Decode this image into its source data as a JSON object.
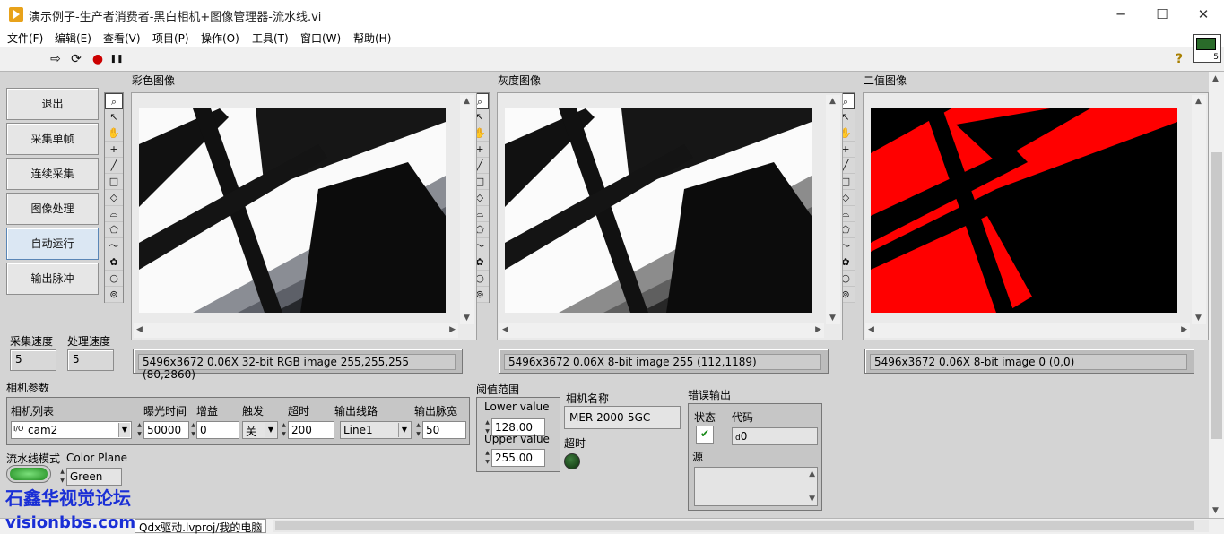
{
  "window": {
    "title": "演示例子-生产者消费者-黑白相机+图像管理器-流水线.vi",
    "min": "─",
    "max": "☐",
    "close": "✕"
  },
  "menu": [
    "文件(F)",
    "编辑(E)",
    "查看(V)",
    "项目(P)",
    "操作(O)",
    "工具(T)",
    "窗口(W)",
    "帮助(H)"
  ],
  "toolbar": {
    "run": "⇨",
    "run_cont": "⟳",
    "abort": "●",
    "pause": "❚❚",
    "help": "?"
  },
  "vi_icon": {
    "number": "5"
  },
  "buttons": [
    "退出",
    "采集单帧",
    "连续采集",
    "图像处理",
    "自动运行",
    "输出脉冲"
  ],
  "displays": [
    {
      "label": "彩色图像",
      "info": "5496x3672 0.06X 32-bit RGB image 255,255,255    (80,2860)"
    },
    {
      "label": "灰度图像",
      "info": "5496x3672 0.06X 8-bit image 255     (112,1189)"
    },
    {
      "label": "二值图像",
      "info": "5496x3672 0.06X 8-bit image 0     (0,0)"
    }
  ],
  "palette_tools": [
    "⌕",
    "↖",
    "✋",
    "+",
    "╱",
    "□",
    "◇",
    "⌓",
    "⬠",
    "〜",
    "✿",
    "○",
    "⊚"
  ],
  "speed": {
    "acq_label": "采集速度",
    "acq_value": "5",
    "proc_label": "处理速度",
    "proc_value": "5"
  },
  "camera": {
    "label": "相机参数",
    "list_label": "相机列表",
    "list_value": "cam2",
    "list_prefix": "I/O",
    "exposure_label": "曝光时间",
    "exposure_value": "50000",
    "gain_label": "增益",
    "gain_value": "0",
    "trigger_label": "触发",
    "trigger_value": "关",
    "timeout_label": "超时",
    "timeout_value": "200",
    "line_label": "输出线路",
    "line_value": "Line1",
    "pulse_label": "输出脉宽",
    "pulse_value": "50"
  },
  "threshold": {
    "label": "阈值范围",
    "lower_label": "Lower value",
    "lower_value": "128.00",
    "upper_label": "Upper value",
    "upper_value": "255.00"
  },
  "camera_name": {
    "label": "相机名称",
    "value": "MER-2000-5GC"
  },
  "timeout_led": {
    "label": "超时"
  },
  "error": {
    "label": "错误输出",
    "status_label": "状态",
    "code_label": "代码",
    "code_value": "0",
    "code_prefix": "d",
    "source_label": "源"
  },
  "pipeline": {
    "label": "流水线模式",
    "plane_label": "Color Plane",
    "plane_value": "Green"
  },
  "watermark": {
    "line1": "石鑫华视觉论坛",
    "line2": "visionbbs.com"
  },
  "status_bar": {
    "text": "Qdx驱动.lvproj/我的电脑"
  }
}
